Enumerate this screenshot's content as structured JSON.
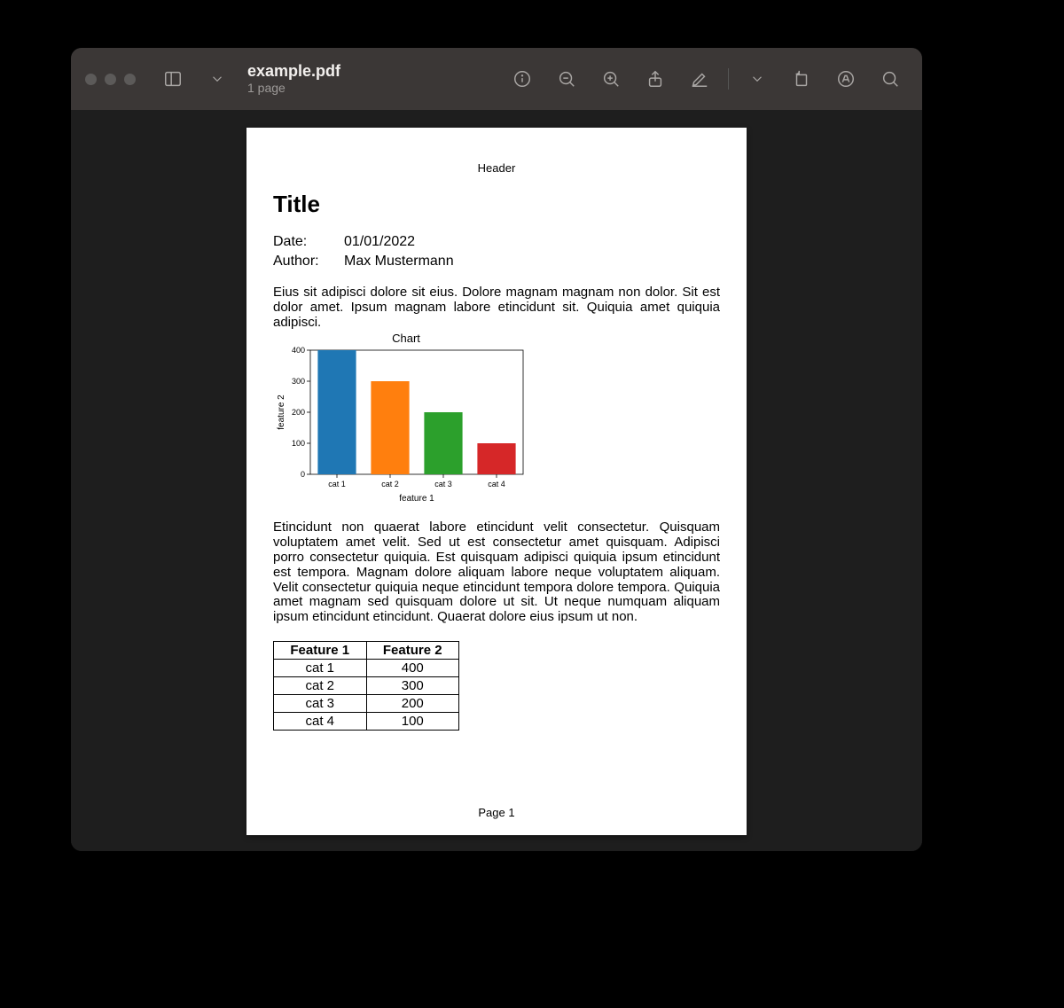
{
  "window": {
    "filename": "example.pdf",
    "page_count_label": "1 page"
  },
  "doc": {
    "header": "Header",
    "title": "Title",
    "meta": {
      "date_label": "Date:",
      "date_value": "01/01/2022",
      "author_label": "Author:",
      "author_value": "Max Mustermann"
    },
    "para1": "Eius sit adipisci dolore sit eius. Dolore magnam magnam non dolor. Sit est dolor amet. Ipsum magnam labore etincidunt sit. Quiquia amet quiquia adipisci.",
    "para2": "Etincidunt non quaerat labore etincidunt velit consectetur. Quisquam voluptatem amet velit. Sed ut est consectetur amet quisquam. Adipisci porro consectetur quiquia. Est quisquam adipisci quiquia ipsum etincidunt est tempora. Magnam dolore aliquam labore neque voluptatem aliquam. Velit consectetur quiquia neque etincidunt tempora dolore tempora. Quiquia amet magnam sed quisquam dolore ut sit. Ut neque numquam aliquam ipsum etincidunt etincidunt. Quaerat dolore eius ipsum ut non.",
    "footer": "Page 1",
    "table": {
      "headers": [
        "Feature 1",
        "Feature 2"
      ],
      "rows": [
        [
          "cat 1",
          "400"
        ],
        [
          "cat 2",
          "300"
        ],
        [
          "cat 3",
          "200"
        ],
        [
          "cat 4",
          "100"
        ]
      ]
    }
  },
  "chart_data": {
    "type": "bar",
    "title": "Chart",
    "xlabel": "feature 1",
    "ylabel": "feature 2",
    "categories": [
      "cat 1",
      "cat 2",
      "cat 3",
      "cat 4"
    ],
    "values": [
      400,
      300,
      200,
      100
    ],
    "ylim": [
      0,
      400
    ],
    "yticks": [
      0,
      100,
      200,
      300,
      400
    ],
    "colors": [
      "#1f77b4",
      "#ff7f0e",
      "#2ca02c",
      "#d62728"
    ]
  }
}
